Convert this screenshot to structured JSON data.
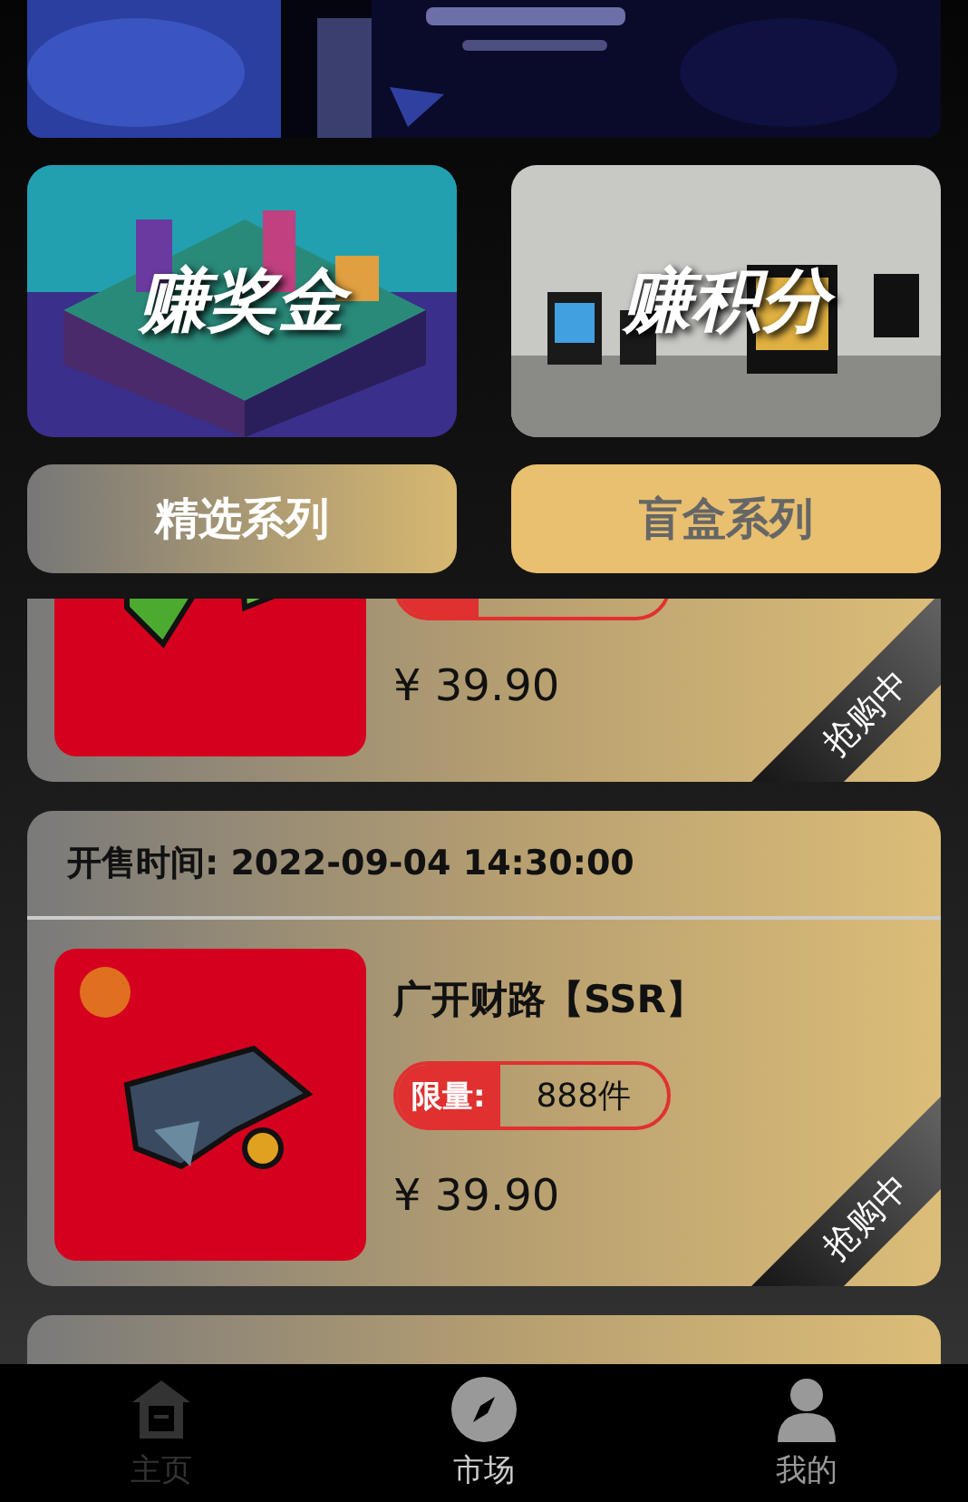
{
  "promo_cards": [
    {
      "label": "赚奖金"
    },
    {
      "label": "赚积分"
    }
  ],
  "tabs": [
    {
      "label": "精选系列",
      "selected": true
    },
    {
      "label": "盲盒系列",
      "selected": false
    }
  ],
  "products": [
    {
      "price": "¥ 39.90",
      "ribbon": "抢购中"
    },
    {
      "sale_time": "开售时间: 2022-09-04 14:30:00",
      "title": "广开财路【SSR】",
      "limit_label": "限量:",
      "limit_count": "888件",
      "price": "¥ 39.90",
      "ribbon": "抢购中"
    }
  ],
  "nav": [
    {
      "label": "主页",
      "selected": false,
      "disabled": true
    },
    {
      "label": "市场",
      "selected": true,
      "disabled": false
    },
    {
      "label": "我的",
      "selected": false,
      "disabled": false
    }
  ]
}
